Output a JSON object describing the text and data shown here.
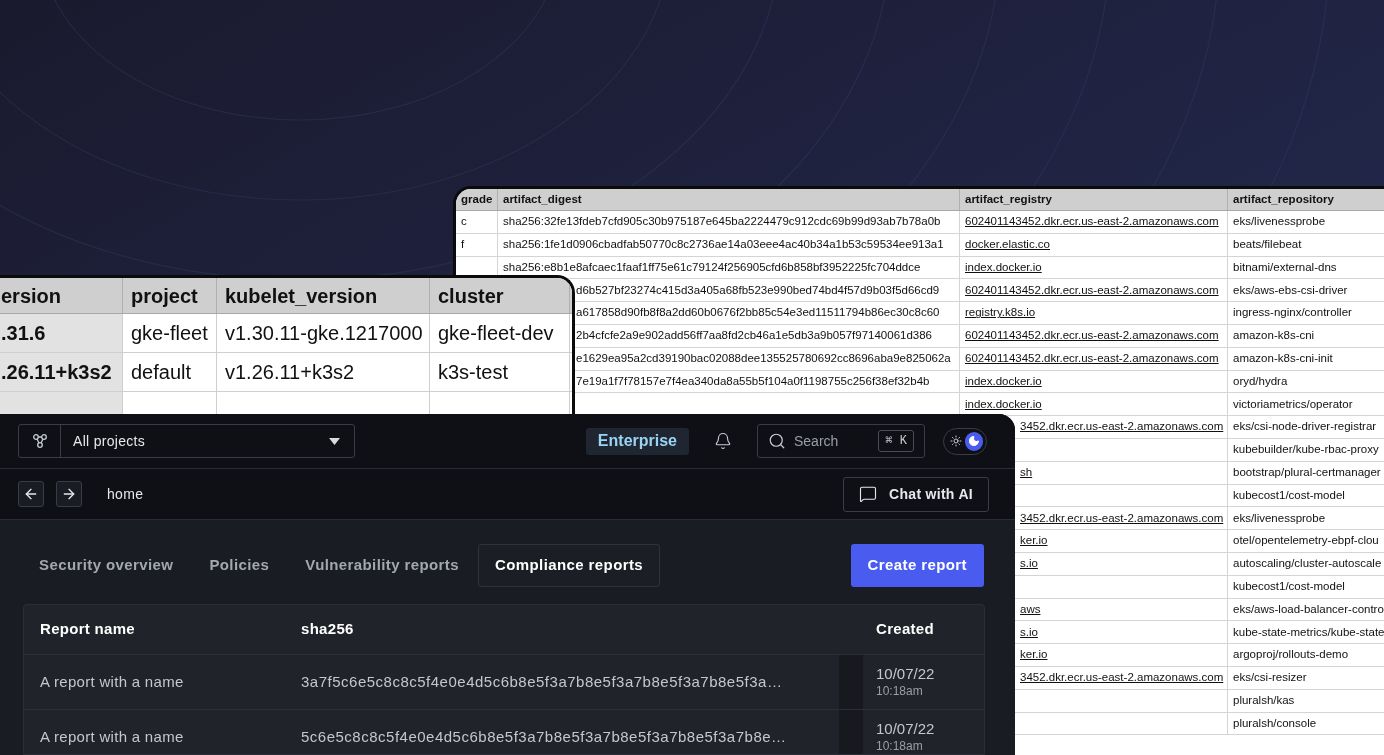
{
  "artifacts_table": {
    "columns": [
      "grade",
      "artifact_digest",
      "artifact_registry",
      "artifact_repository"
    ],
    "rows": [
      {
        "grade": "c",
        "artifact_digest": "sha256:32fe13fdeb7cfd905c30b975187e645ba2224479c912cdc69b99d93ab7b78a0b",
        "artifact_registry": "602401143452.dkr.ecr.us-east-2.amazonaws.com",
        "artifact_repository": "eks/livenessprobe"
      },
      {
        "grade": "f",
        "artifact_digest": "sha256:1fe1d0906cbadfab50770c8c2736ae14a03eee4ac40b34a1b53c59534ee913a1",
        "artifact_registry": "docker.elastic.co",
        "artifact_repository": "beats/filebeat"
      },
      {
        "artifact_digest": "sha256:e8b1e8afcaec1faaf1ff75e61c79124f256905cfd6b858bf3952225fc704ddce",
        "artifact_registry": "index.docker.io",
        "artifact_repository": "bitnami/external-dns"
      },
      {
        "artifact_digest": "d6b527bf23274c415d3a405a68fb523e990bed74bd4f57d9b03f5d66cd9",
        "artifact_registry": "602401143452.dkr.ecr.us-east-2.amazonaws.com",
        "artifact_repository": "eks/aws-ebs-csi-driver"
      },
      {
        "artifact_digest": "a617858d90fb8f8a2dd60b0676f2bb85c54e3ed11511794b86ec30c8c60",
        "artifact_registry": "registry.k8s.io",
        "artifact_repository": "ingress-nginx/controller"
      },
      {
        "artifact_digest": "2b4cfcfe2a9e902add56ff7aa8fd2cb46a1e5db3a9b057f97140061d386",
        "artifact_registry": "602401143452.dkr.ecr.us-east-2.amazonaws.com",
        "artifact_repository": "amazon-k8s-cni"
      },
      {
        "artifact_digest": "e1629ea95a2cd39190bac02088dee135525780692cc8696aba9e825062a",
        "artifact_registry": "602401143452.dkr.ecr.us-east-2.amazonaws.com",
        "artifact_repository": "amazon-k8s-cni-init"
      },
      {
        "artifact_digest": "7e19a1f7f78157e7f4ea340da8a55b5f104a0f1198755c256f38ef32b4b",
        "artifact_registry": "index.docker.io",
        "artifact_repository": "oryd/hydra"
      },
      {
        "artifact_registry": "index.docker.io",
        "artifact_repository": "victoriametrics/operator"
      },
      {
        "artifact_registry": "3452.dkr.ecr.us-east-2.amazonaws.com",
        "artifact_repository": "eks/csi-node-driver-registrar"
      },
      {
        "artifact_repository": "kubebuilder/kube-rbac-proxy"
      },
      {
        "artifact_registry": "sh",
        "artifact_repository": "bootstrap/plural-certmanager"
      },
      {
        "artifact_repository": "kubecost1/cost-model"
      },
      {
        "artifact_registry": "3452.dkr.ecr.us-east-2.amazonaws.com",
        "artifact_repository": "eks/livenessprobe"
      },
      {
        "artifact_registry": "ker.io",
        "artifact_repository": "otel/opentelemetry-ebpf-clou"
      },
      {
        "artifact_registry": "s.io",
        "artifact_repository": "autoscaling/cluster-autoscale"
      },
      {
        "artifact_repository": "kubecost1/cost-model"
      },
      {
        "artifact_registry": "aws",
        "artifact_repository": "eks/aws-load-balancer-contro"
      },
      {
        "artifact_registry": "s.io",
        "artifact_repository": "kube-state-metrics/kube-state"
      },
      {
        "artifact_registry": "ker.io",
        "artifact_repository": "argoproj/rollouts-demo"
      },
      {
        "artifact_registry": "3452.dkr.ecr.us-east-2.amazonaws.com",
        "artifact_repository": "eks/csi-resizer"
      },
      {
        "artifact_repository": "pluralsh/kas"
      },
      {
        "artifact_repository": "pluralsh/console"
      }
    ]
  },
  "clusters_table": {
    "columns": [
      "ersion",
      "project",
      "kubelet_version",
      "cluster"
    ],
    "rows": [
      {
        "version": ".31.6",
        "project": "gke-fleet",
        "kubelet_version": "v1.30.11-gke.1217000",
        "cluster": "gke-fleet-dev"
      },
      {
        "version": ".26.11+k3s2",
        "project": "default",
        "kubelet_version": "v1.26.11+k3s2",
        "cluster": "k3s-test"
      }
    ]
  },
  "app": {
    "topbar": {
      "project_selector": "All projects",
      "badge": "Enterprise",
      "search": {
        "placeholder": "Search",
        "shortcut": "⌘ K"
      },
      "dark_mode": true
    },
    "nav": {
      "location": "home",
      "chat_button": "Chat with AI"
    },
    "tabs": [
      {
        "label": "Security overview",
        "selected": false
      },
      {
        "label": "Policies",
        "selected": false
      },
      {
        "label": "Vulnerability reports",
        "selected": false
      },
      {
        "label": "Compliance reports",
        "selected": true
      }
    ],
    "create_button": "Create report",
    "reports": {
      "columns": [
        "Report name",
        "sha256",
        "Created"
      ],
      "rows": [
        {
          "name": "A report with a name",
          "sha256": "3a7f5c6e5c8c8c5f4e0e4d5c6b8e5f3a7b8e5f3a7b8e5f3a7b8e5f3a…",
          "date": "10/07/22",
          "time": "10:18am"
        },
        {
          "name": "A report with a name",
          "sha256": "5c6e5c8c8c5f4e0e4d5c6b8e5f3a7b8e5f3a7b8e5f3a7b8e5f3a7b8e…",
          "date": "10/07/22",
          "time": "10:18am"
        }
      ]
    }
  }
}
